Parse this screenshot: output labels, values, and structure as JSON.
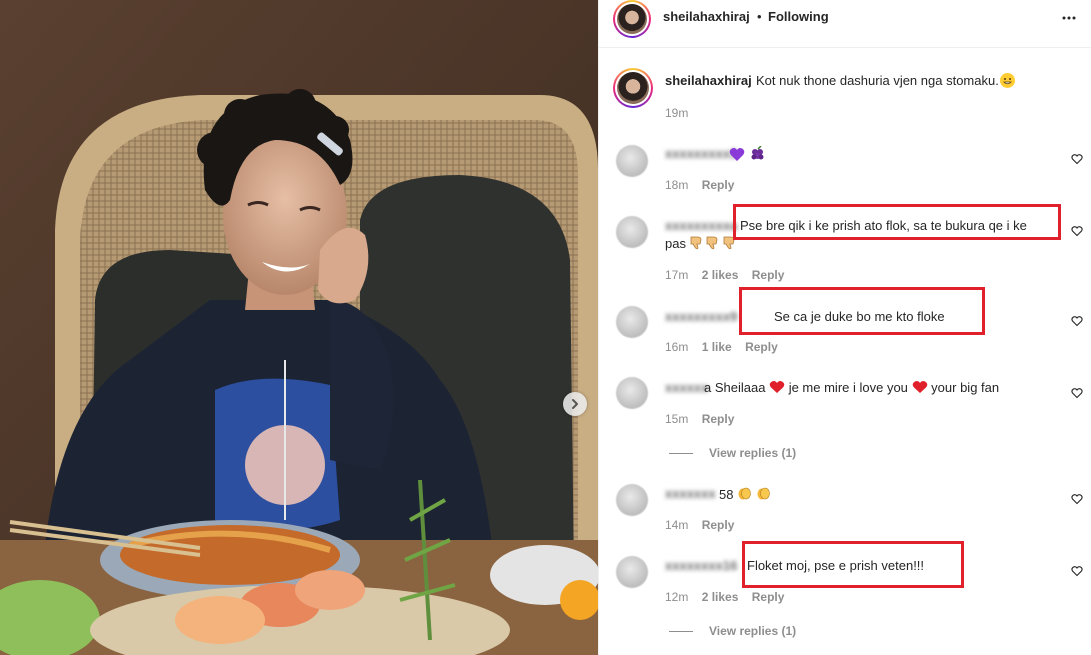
{
  "post": {
    "username": "sheilahaxhiraj",
    "separator": "•",
    "follow_status": "Following",
    "more_icon": "more-horizontal-icon"
  },
  "caption": {
    "username": "sheilahaxhiraj",
    "text": "Kot nuk thone dashuria vjen nga stomaku.",
    "time": "19m"
  },
  "comments": [
    {
      "user": "xxxxxxxxx3",
      "text": "",
      "emoji": [
        "purple-heart",
        "grapes"
      ],
      "time": "18m",
      "likes": "",
      "reply": "Reply"
    },
    {
      "user": "xxxxxxxxxa",
      "text": "Pse bre qik i ke prish ato flok, sa te bukura qe i ke",
      "text2": "pas",
      "emoji": [
        "thumbs-down",
        "thumbs-down",
        "thumbs-down"
      ],
      "time": "17m",
      "likes": "2 likes",
      "reply": "Reply"
    },
    {
      "user": "xxxxxxxxx9",
      "text": "Se ca je duke bo me kto floke",
      "time": "16m",
      "likes": "1 like",
      "reply": "Reply"
    },
    {
      "user": "xxxxxx",
      "text_a": "a Sheilaaa",
      "text_b": "je me mire i love you",
      "text_c": "your big fan",
      "time": "15m",
      "likes": "",
      "reply": "Reply",
      "view_replies": "View replies (1)"
    },
    {
      "user": "xxxxxxx",
      "text": "58",
      "emoji": [
        "clap",
        "clap"
      ],
      "time": "14m",
      "likes": "",
      "reply": "Reply"
    },
    {
      "user": "xxxxxxxx16",
      "text": "Floket moj, pse e prish veten!!!",
      "time": "12m",
      "likes": "2 likes",
      "reply": "Reply",
      "view_replies": "View replies (1)"
    }
  ],
  "colors": {
    "highlight": "#e0202a",
    "secondary_text": "#8e8e8e",
    "primary_text": "#262626"
  }
}
